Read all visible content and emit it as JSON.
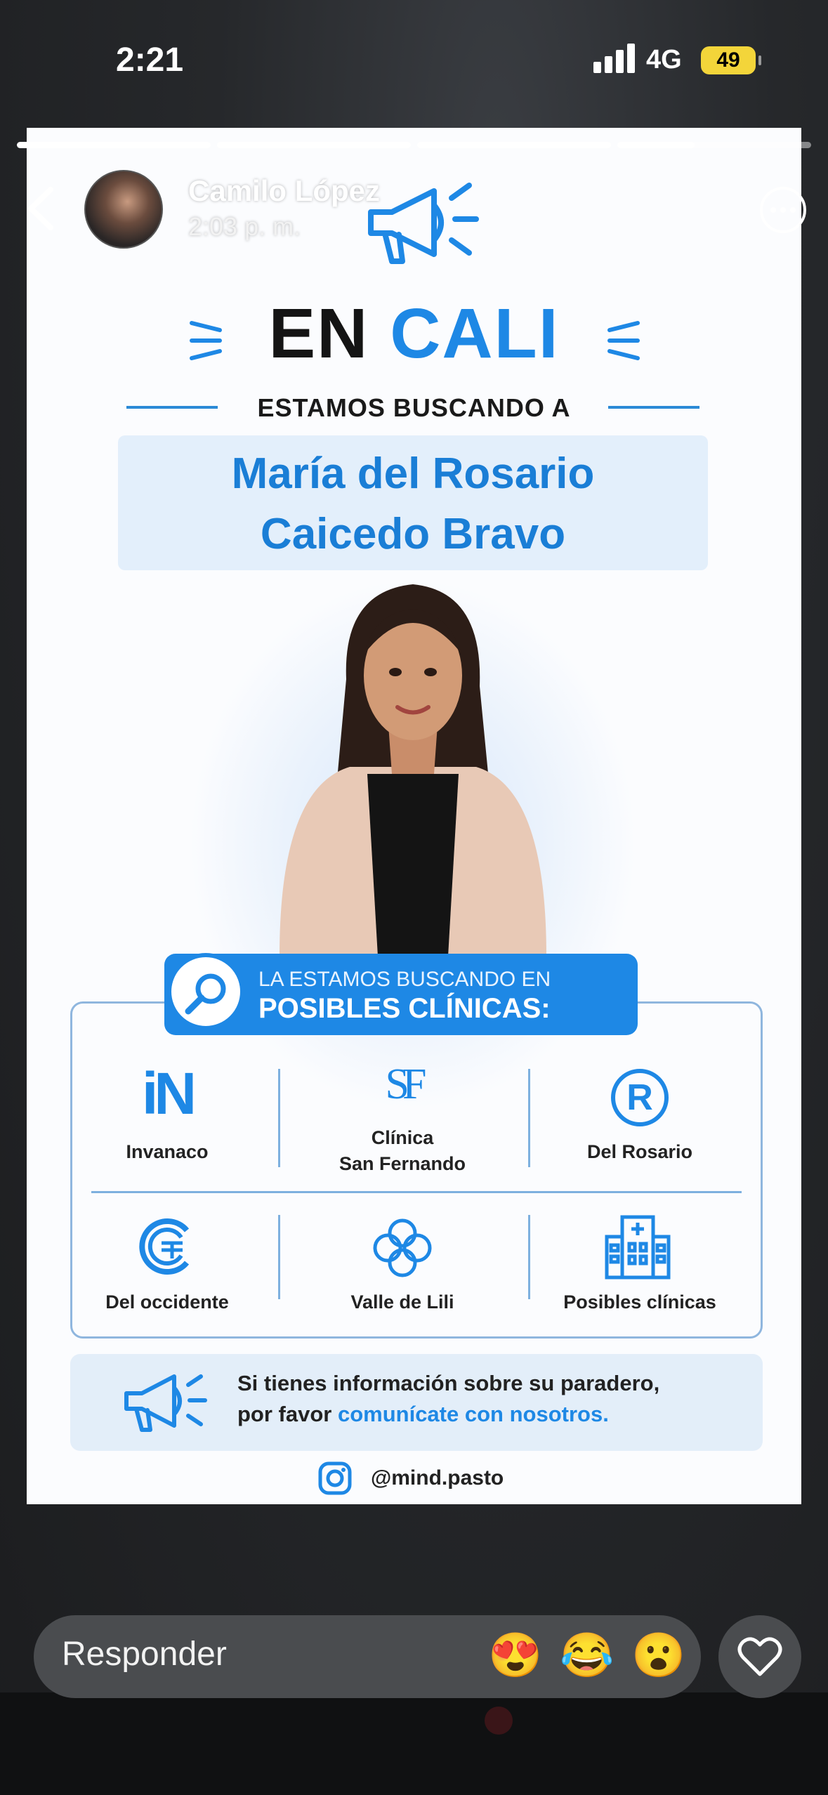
{
  "status_bar": {
    "time": "2:21",
    "network": "4G",
    "battery": "49"
  },
  "story": {
    "progress": [
      1.0,
      1.0,
      1.0,
      0.4
    ],
    "username": "Camilo López",
    "time": "2:03 p. m."
  },
  "poster": {
    "title_part1": "EN",
    "title_part2": "CALI",
    "subtitle": "ESTAMOS BUSCANDO A",
    "name_line1": "María del Rosario",
    "name_line2": "Caicedo Bravo",
    "banner_line1": "LA ESTAMOS BUSCANDO EN",
    "banner_line2": "POSIBLES CLÍNICAS:",
    "clinics": [
      {
        "label": "Invanaco",
        "logo_text": "iN",
        "icon": "invanaco-logo"
      },
      {
        "label": "Clínica San Fernando",
        "line1": "Clínica",
        "line2": "San Fernando",
        "logo_text": "SF",
        "icon": "san-fernando-logo"
      },
      {
        "label": "Del Rosario",
        "logo_text": "R",
        "icon": "del-rosario-logo"
      },
      {
        "label": "Del occidente",
        "icon": "del-occidente-logo"
      },
      {
        "label": "Valle de Lili",
        "icon": "valle-de-lili-logo"
      },
      {
        "label": "Posibles clínicas",
        "icon": "hospital-building-icon"
      }
    ],
    "info_line1": "Si tienes información sobre su paradero,",
    "info_line2_plain": "por favor ",
    "info_line2_highlight": "comunícate con nosotros.",
    "instagram_handle": "@mind.pasto",
    "accent_color": "#1e88e5"
  },
  "reply_bar": {
    "placeholder": "Responder",
    "reactions": [
      "😍",
      "😂",
      "😮"
    ]
  }
}
